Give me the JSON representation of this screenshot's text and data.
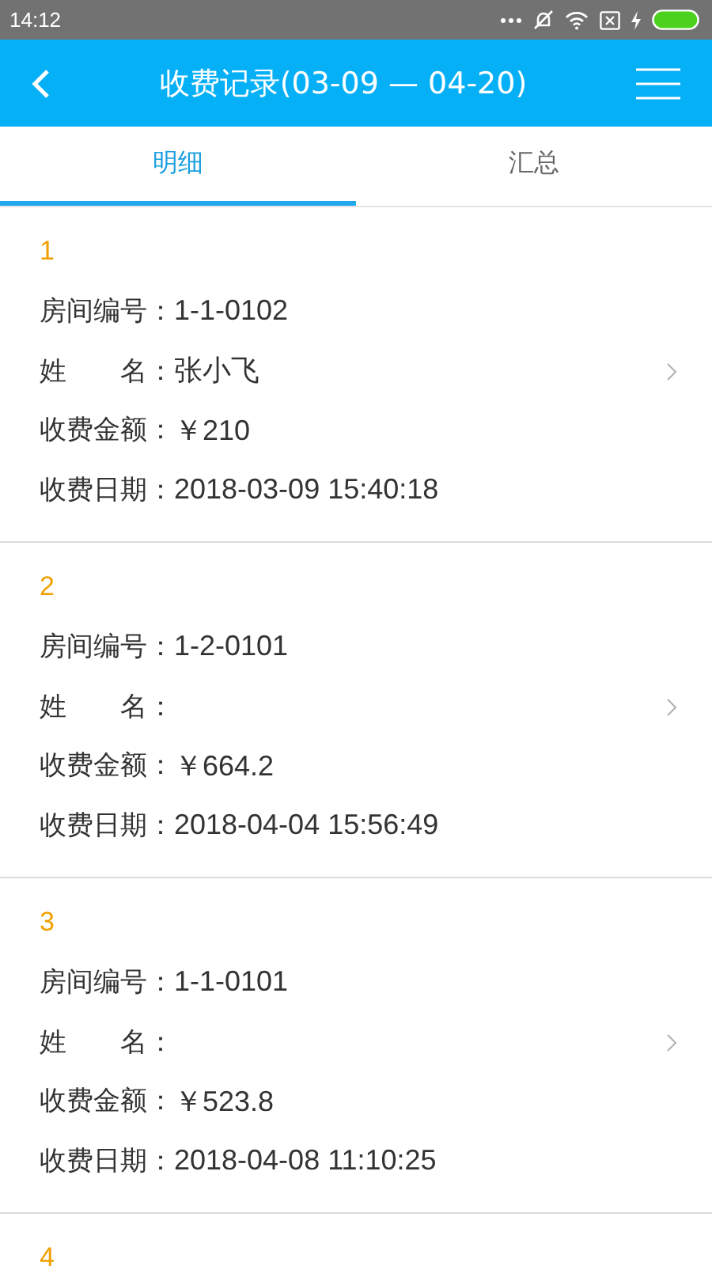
{
  "status_bar": {
    "time": "14:12"
  },
  "header": {
    "title": "收费记录(03-09 — 04-20)"
  },
  "tabs": [
    {
      "label": "明细",
      "selected": true
    },
    {
      "label": "汇总",
      "selected": false
    }
  ],
  "records": [
    {
      "number": "1",
      "fields": [
        {
          "label": "房间编号：",
          "value": "1-1-0102"
        },
        {
          "label": "姓　　名：",
          "value": "张小飞"
        },
        {
          "label": "收费金额：",
          "value": "￥210"
        },
        {
          "label": "收费日期：",
          "value": "2018-03-09 15:40:18"
        }
      ]
    },
    {
      "number": "2",
      "fields": [
        {
          "label": "房间编号：",
          "value": "1-2-0101"
        },
        {
          "label": "姓　　名："
        },
        {
          "label": "收费金额：",
          "value": "￥664.2"
        },
        {
          "label": "收费日期：",
          "value": "2018-04-04 15:56:49"
        }
      ]
    },
    {
      "number": "3",
      "fields": [
        {
          "label": "房间编号：",
          "value": "1-1-0101"
        },
        {
          "label": "姓　　名："
        },
        {
          "label": "收费金额：",
          "value": "￥523.8"
        },
        {
          "label": "收费日期：",
          "value": "2018-04-08 11:10:25"
        }
      ]
    },
    {
      "number": "4"
    }
  ]
}
